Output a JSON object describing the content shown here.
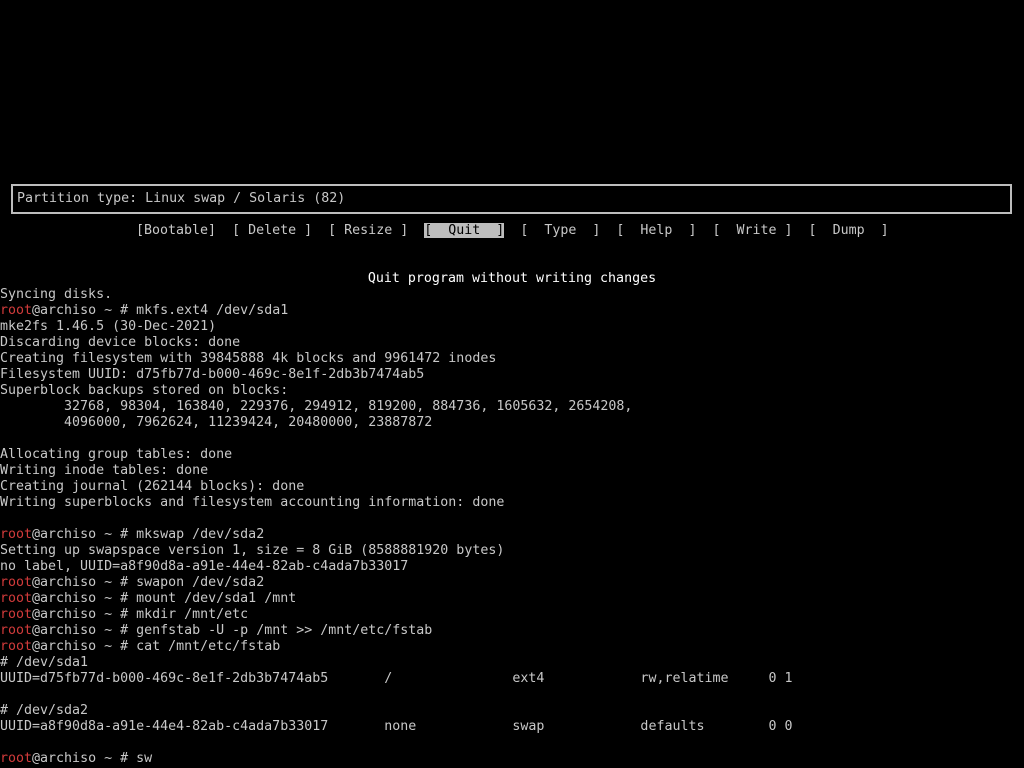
{
  "cfdisk": {
    "partition_type": "Partition type: Linux swap / Solaris (82)",
    "menu": [
      {
        "label": "[Bootable]",
        "selected": false
      },
      {
        "label": "[ Delete ]",
        "selected": false
      },
      {
        "label": "[ Resize ]",
        "selected": false
      },
      {
        "label": "[  Quit  ]",
        "selected": true
      },
      {
        "label": "[  Type  ]",
        "selected": false
      },
      {
        "label": "[  Help  ]",
        "selected": false
      },
      {
        "label": "[  Write ]",
        "selected": false
      },
      {
        "label": "[  Dump  ]",
        "selected": false
      }
    ],
    "description": "Quit program without writing changes"
  },
  "terminal": {
    "user": "root",
    "prompt_suffix": "@archiso ~ # ",
    "lines": [
      {
        "type": "out",
        "text": "Syncing disks."
      },
      {
        "type": "cmd",
        "text": "mkfs.ext4 /dev/sda1"
      },
      {
        "type": "out",
        "text": "mke2fs 1.46.5 (30-Dec-2021)"
      },
      {
        "type": "out",
        "text": "Discarding device blocks: done"
      },
      {
        "type": "out",
        "text": "Creating filesystem with 39845888 4k blocks and 9961472 inodes"
      },
      {
        "type": "out",
        "text": "Filesystem UUID: d75fb77d-b000-469c-8e1f-2db3b7474ab5"
      },
      {
        "type": "out",
        "text": "Superblock backups stored on blocks:"
      },
      {
        "type": "out",
        "text": "        32768, 98304, 163840, 229376, 294912, 819200, 884736, 1605632, 2654208,"
      },
      {
        "type": "out",
        "text": "        4096000, 7962624, 11239424, 20480000, 23887872"
      },
      {
        "type": "out",
        "text": ""
      },
      {
        "type": "out",
        "text": "Allocating group tables: done"
      },
      {
        "type": "out",
        "text": "Writing inode tables: done"
      },
      {
        "type": "out",
        "text": "Creating journal (262144 blocks): done"
      },
      {
        "type": "out",
        "text": "Writing superblocks and filesystem accounting information: done"
      },
      {
        "type": "out",
        "text": ""
      },
      {
        "type": "cmd",
        "text": "mkswap /dev/sda2"
      },
      {
        "type": "out",
        "text": "Setting up swapspace version 1, size = 8 GiB (8588881920 bytes)"
      },
      {
        "type": "out",
        "text": "no label, UUID=a8f90d8a-a91e-44e4-82ab-c4ada7b33017"
      },
      {
        "type": "cmd",
        "text": "swapon /dev/sda2"
      },
      {
        "type": "cmd",
        "text": "mount /dev/sda1 /mnt"
      },
      {
        "type": "cmd",
        "text": "mkdir /mnt/etc"
      },
      {
        "type": "cmd",
        "text": "genfstab -U -p /mnt >> /mnt/etc/fstab"
      },
      {
        "type": "cmd",
        "text": "cat /mnt/etc/fstab"
      },
      {
        "type": "out",
        "text": "# /dev/sda1"
      },
      {
        "type": "out",
        "text": "UUID=d75fb77d-b000-469c-8e1f-2db3b7474ab5       /               ext4            rw,relatime     0 1"
      },
      {
        "type": "out",
        "text": ""
      },
      {
        "type": "out",
        "text": "# /dev/sda2"
      },
      {
        "type": "out",
        "text": "UUID=a8f90d8a-a91e-44e4-82ab-c4ada7b33017       none            swap            defaults        0 0"
      },
      {
        "type": "out",
        "text": ""
      },
      {
        "type": "cmd",
        "text": "sw"
      }
    ]
  }
}
